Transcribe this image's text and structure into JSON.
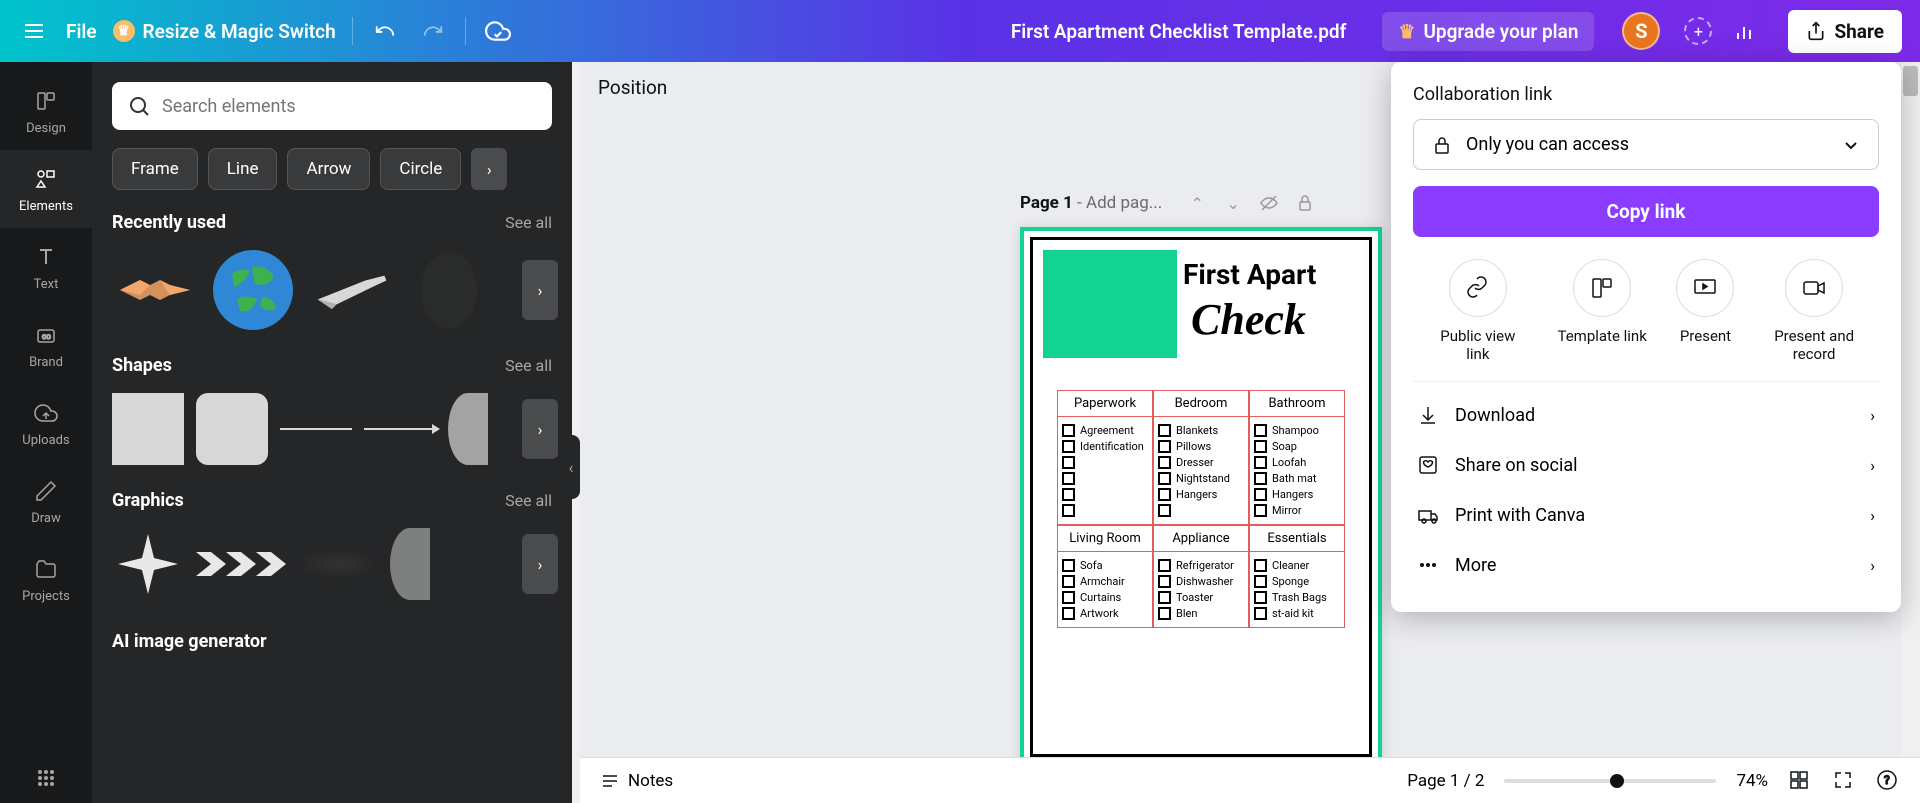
{
  "header": {
    "file_label": "File",
    "resize_label": "Resize & Magic Switch",
    "doc_title": "First Apartment Checklist Template.pdf",
    "upgrade_label": "Upgrade your plan",
    "avatar_initial": "S",
    "share_label": "Share"
  },
  "rail": {
    "design": "Design",
    "elements": "Elements",
    "text": "Text",
    "brand": "Brand",
    "uploads": "Uploads",
    "draw": "Draw",
    "projects": "Projects"
  },
  "elements_panel": {
    "search_placeholder": "Search elements",
    "chips": [
      "Frame",
      "Line",
      "Arrow",
      "Circle"
    ],
    "recently_used": "Recently used",
    "shapes": "Shapes",
    "graphics": "Graphics",
    "ai_image": "AI image generator",
    "see_all": "See all"
  },
  "canvas": {
    "position_label": "Position",
    "page_label_prefix": "Page 1",
    "page_label_suffix": " - Add pag...",
    "doc_title_line": "First Apart",
    "doc_script_line": "Check",
    "columns": [
      {
        "header": "Paperwork",
        "items": [
          "Agreement",
          "Identification"
        ]
      },
      {
        "header": "Bedroom",
        "items": [
          "Blankets",
          "Pillows",
          "Dresser",
          "Nightstand",
          "Hangers"
        ]
      },
      {
        "header": "Bathroom",
        "items": [
          "Shampoo",
          "Soap",
          "Loofah",
          "Bath mat",
          "Hangers",
          "Mirror"
        ]
      },
      {
        "header": "Living Room",
        "items": [
          "Sofa",
          "Armchair",
          "Curtains",
          "Artwork"
        ]
      },
      {
        "header": "Appliance",
        "items": [
          "Refrigerator",
          "Dishwasher",
          "Toaster",
          "Blen"
        ]
      },
      {
        "header": "Essentials",
        "items": [
          "Cleaner",
          "Sponge",
          "Trash Bags",
          "st-aid kit"
        ]
      }
    ]
  },
  "bottom": {
    "notes": "Notes",
    "page_count": "Page 1 / 2",
    "zoom": "74%"
  },
  "share_popover": {
    "collab_label": "Collaboration link",
    "access_text": "Only you can access",
    "copy_link": "Copy link",
    "options": [
      {
        "label": "Public view link"
      },
      {
        "label": "Template link"
      },
      {
        "label": "Present"
      },
      {
        "label": "Present and record"
      }
    ],
    "actions": {
      "download": "Download",
      "social": "Share on social",
      "print": "Print with Canva",
      "more": "More"
    }
  }
}
